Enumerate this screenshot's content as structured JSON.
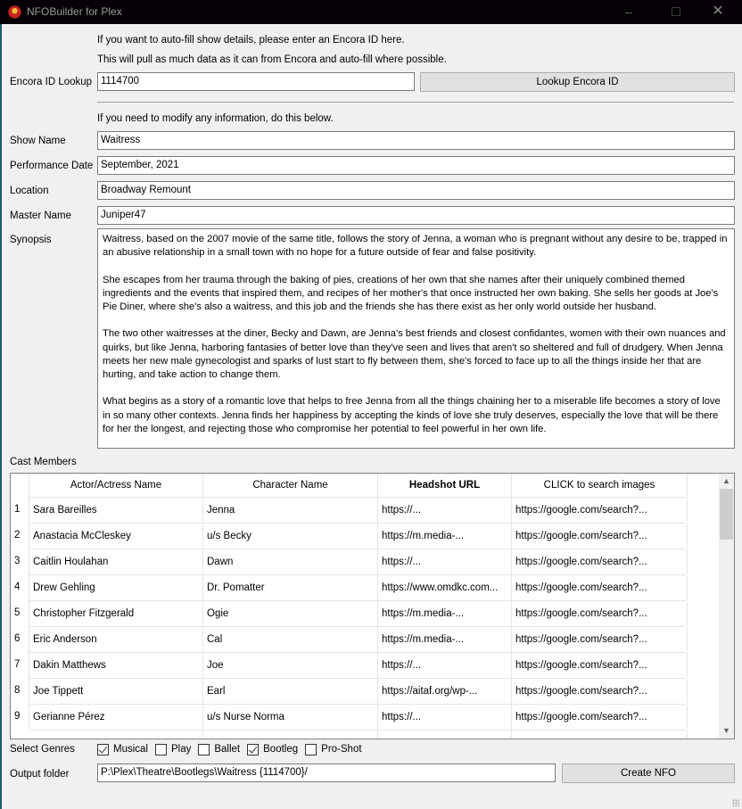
{
  "window": {
    "title": "NFOBuilder for Plex",
    "app_icon": "plex-logo-icon",
    "controls": {
      "minimize": "–",
      "close": "✕"
    }
  },
  "lookup": {
    "hint_line1": "If you want to auto-fill show details, please enter an Encora ID here.",
    "hint_line2": "This will pull as much data as it can from Encora and auto-fill where possible.",
    "label": "Encora ID Lookup",
    "value": "1114700",
    "button_label": "Lookup Encora ID"
  },
  "details": {
    "hint": "If you need to modify any information, do this below.",
    "fields": [
      {
        "label": "Show Name",
        "value": "Waitress"
      },
      {
        "label": "Performance Date",
        "value": "September, 2021"
      },
      {
        "label": "Location",
        "value": "Broadway Remount"
      },
      {
        "label": "Master Name",
        "value": "Juniper47"
      }
    ],
    "synopsis_label": "Synopsis",
    "synopsis": [
      "Waitress, based on the 2007 movie of the same title, follows the story of Jenna, a woman who is pregnant without any desire to be, trapped in an abusive relationship in a small town with no hope for a future outside of fear and false positivity.",
      "She escapes from her trauma through the baking of pies, creations of her own that she names after their uniquely combined themed ingredients and the events that inspired them, and recipes of her mother's that once instructed her own baking. She sells her goods at Joe's Pie Diner, where she's also a waitress, and this job and the friends she has there exist as her only world outside her husband.",
      "The two other waitresses at the diner, Becky and Dawn, are Jenna's best friends and closest confidantes, women with their own nuances and quirks, but like Jenna, harboring fantasies of better love than they've seen and lives that aren't so sheltered and full of drudgery. When Jenna meets her new male gynecologist and sparks of lust start to fly between them, she's forced to face up to all the things inside her that are hurting, and take action to change them.",
      "What begins as a story of a romantic love that helps to free Jenna from all the things chaining her to a miserable life becomes a story of love in so many other contexts. Jenna finds her happiness by accepting the kinds of love she truly deserves, especially the love that will be there for her the longest, and rejecting those who compromise her potential to feel powerful in her own life."
    ]
  },
  "cast": {
    "label": "Cast Members",
    "columns": [
      "Actor/Actress Name",
      "Character Name",
      "Headshot URL",
      "CLICK to search images"
    ],
    "rows": [
      {
        "n": "1",
        "actor": "Sara Bareilles",
        "character": "Jenna",
        "headshot": "https://...",
        "search": "https://google.com/search?..."
      },
      {
        "n": "2",
        "actor": "Anastacia McCleskey",
        "character": "u/s Becky",
        "headshot": "https://m.media-...",
        "search": "https://google.com/search?..."
      },
      {
        "n": "3",
        "actor": "Caitlin Houlahan",
        "character": "Dawn",
        "headshot": "https://...",
        "search": "https://google.com/search?..."
      },
      {
        "n": "4",
        "actor": "Drew Gehling",
        "character": "Dr. Pomatter",
        "headshot": "https://www.omdkc.com...",
        "search": "https://google.com/search?..."
      },
      {
        "n": "5",
        "actor": "Christopher Fitzgerald",
        "character": "Ogie",
        "headshot": "https://m.media-...",
        "search": "https://google.com/search?..."
      },
      {
        "n": "6",
        "actor": "Eric Anderson",
        "character": "Cal",
        "headshot": "https://m.media-...",
        "search": "https://google.com/search?..."
      },
      {
        "n": "7",
        "actor": "Dakin Matthews",
        "character": "Joe",
        "headshot": "https://...",
        "search": "https://google.com/search?..."
      },
      {
        "n": "8",
        "actor": "Joe Tippett",
        "character": "Earl",
        "headshot": "https://aitaf.org/wp-...",
        "search": "https://google.com/search?..."
      },
      {
        "n": "9",
        "actor": "Gerianne Pérez",
        "character": "u/s Nurse Norma",
        "headshot": "https://...",
        "search": "https://google.com/search?..."
      }
    ]
  },
  "genres": {
    "label": "Select Genres",
    "options": [
      {
        "label": "Musical",
        "checked": true
      },
      {
        "label": "Play",
        "checked": false
      },
      {
        "label": "Ballet",
        "checked": false
      },
      {
        "label": "Bootleg",
        "checked": true
      },
      {
        "label": "Pro-Shot",
        "checked": false
      }
    ]
  },
  "output": {
    "label": "Output folder",
    "value": "P:\\Plex\\Theatre\\Bootlegs\\Waitress {1114700}/",
    "button_label": "Create NFO"
  }
}
